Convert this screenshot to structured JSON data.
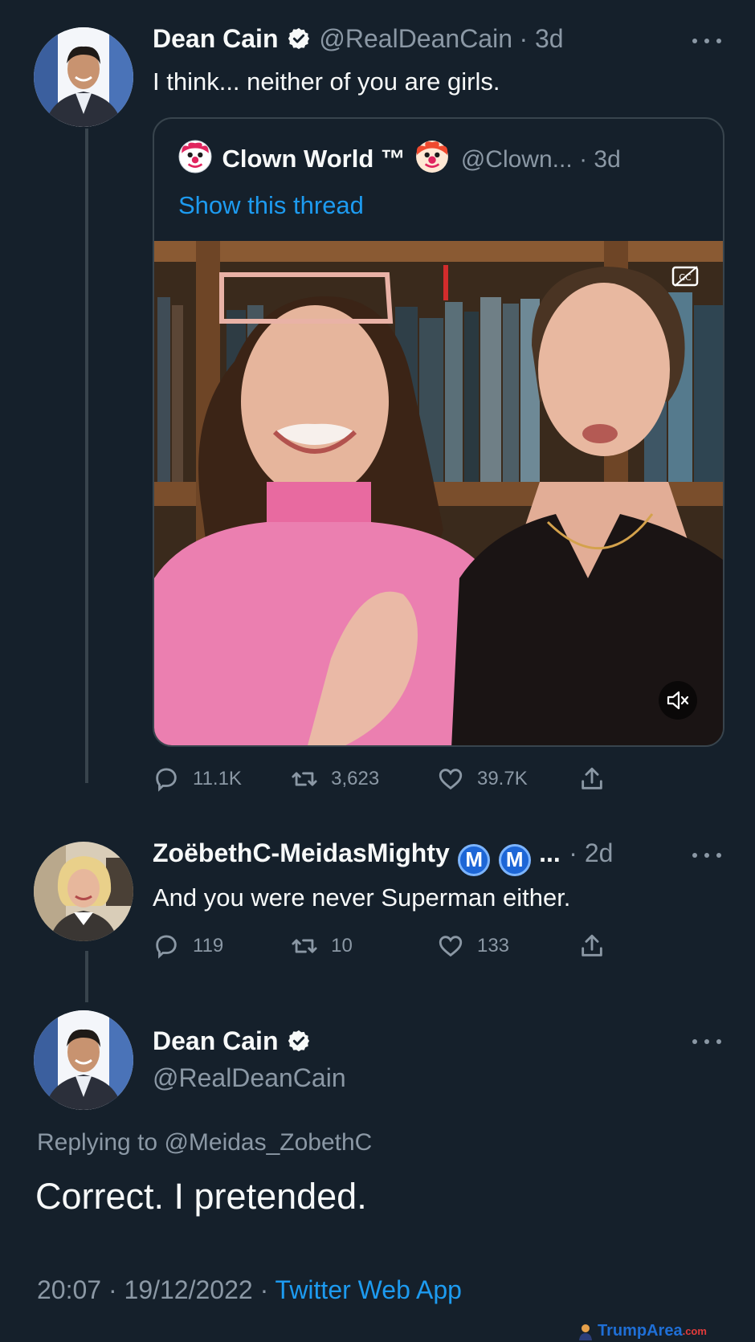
{
  "tweet1": {
    "name": "Dean Cain",
    "handle": "@RealDeanCain",
    "time": "· 3d",
    "text": "I think... neither of you are girls."
  },
  "quote": {
    "name": "Clown World ™",
    "handle": "@Clown...",
    "time": "· 3d",
    "show_thread": "Show this thread"
  },
  "tweet1_actions": {
    "replies": "11.1K",
    "retweets": "3,623",
    "likes": "39.7K"
  },
  "tweet2": {
    "name": "ZoëbethC-MeidasMighty",
    "badge1": "M",
    "badge2": "M",
    "ellipsis": "...",
    "time": "· 2d",
    "text": "And you were never Superman either."
  },
  "tweet2_actions": {
    "replies": "119",
    "retweets": "10",
    "likes": "133"
  },
  "main_tweet": {
    "name": "Dean Cain",
    "handle": "@RealDeanCain",
    "replying_prefix": "Replying to",
    "replying_to": "@Meidas_ZobethC",
    "text": "Correct. I pretended.",
    "timestamp": "20:07 · 19/12/2022 ·",
    "source": "Twitter Web App"
  },
  "watermark": {
    "brand": "TrumpArea",
    "suffix": ".com"
  },
  "colors": {
    "background": "#15202b",
    "accent": "#1d9bf0",
    "muted": "#8b98a5",
    "border": "#38444d"
  }
}
